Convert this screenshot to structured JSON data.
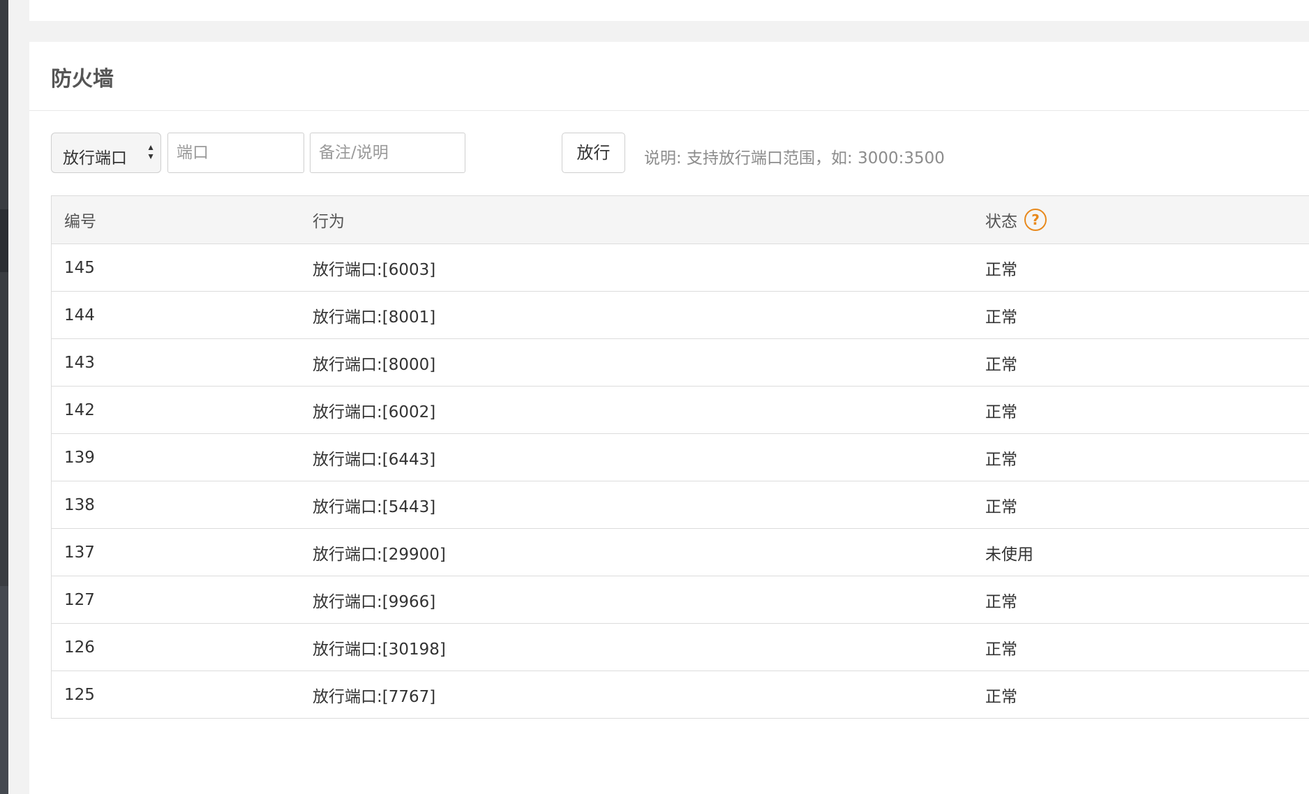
{
  "section": {
    "title": "防火墙"
  },
  "toolbar": {
    "select_value": "放行端口",
    "port_placeholder": "端口",
    "note_placeholder": "备注/说明",
    "submit_label": "放行",
    "hint": "说明: 支持放行端口范围，如: 3000:3500"
  },
  "table": {
    "headers": {
      "id": "编号",
      "action": "行为",
      "status": "状态",
      "help_icon": "?"
    },
    "rows": [
      {
        "id": "145",
        "action": "放行端口:[6003]",
        "status": "正常"
      },
      {
        "id": "144",
        "action": "放行端口:[8001]",
        "status": "正常"
      },
      {
        "id": "143",
        "action": "放行端口:[8000]",
        "status": "正常"
      },
      {
        "id": "142",
        "action": "放行端口:[6002]",
        "status": "正常"
      },
      {
        "id": "139",
        "action": "放行端口:[6443]",
        "status": "正常"
      },
      {
        "id": "138",
        "action": "放行端口:[5443]",
        "status": "正常"
      },
      {
        "id": "137",
        "action": "放行端口:[29900]",
        "status": "未使用"
      },
      {
        "id": "127",
        "action": "放行端口:[9966]",
        "status": "正常"
      },
      {
        "id": "126",
        "action": "放行端口:[30198]",
        "status": "正常"
      },
      {
        "id": "125",
        "action": "放行端口:[7767]",
        "status": "正常"
      }
    ]
  },
  "colors": {
    "accent": "#e8891c",
    "panel_bg": "#ffffff",
    "page_bg": "#f2f2f2"
  }
}
